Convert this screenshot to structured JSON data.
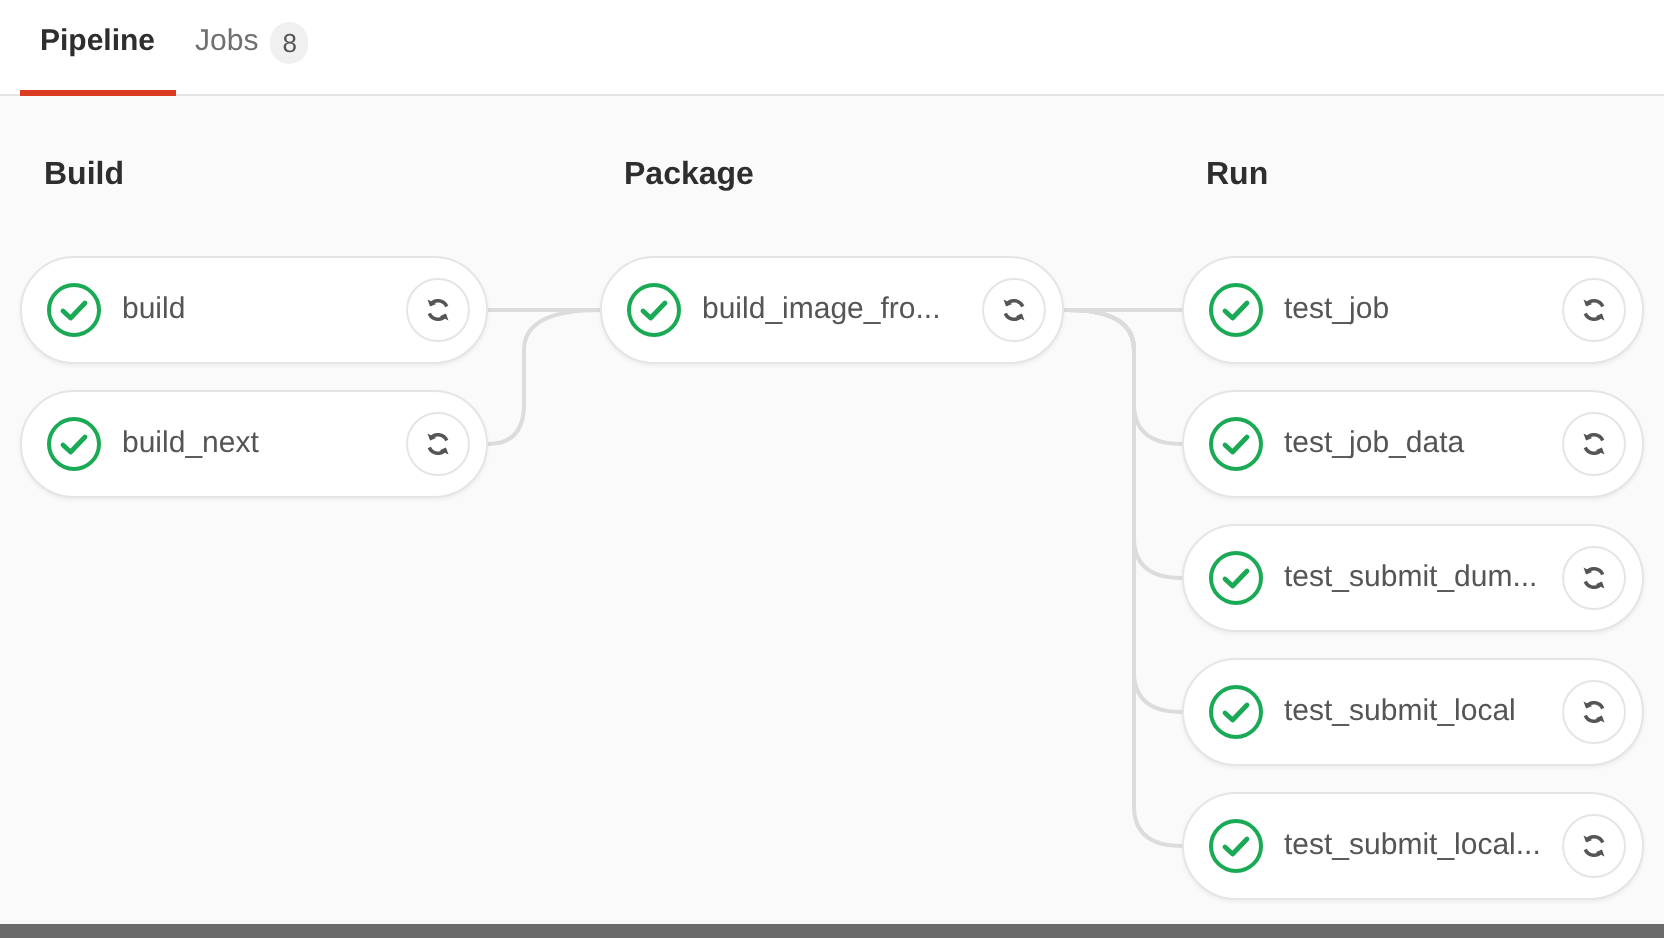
{
  "tabs": [
    {
      "label": "Pipeline",
      "selected": true
    },
    {
      "label": "Jobs",
      "count": "8",
      "selected": false
    }
  ],
  "stages": [
    {
      "title": "Build",
      "jobs": [
        {
          "name": "build",
          "passed": true
        },
        {
          "name": "build_next",
          "passed": true
        }
      ]
    },
    {
      "title": "Package",
      "jobs": [
        {
          "name": "build_image_fro...",
          "passed": true
        }
      ]
    },
    {
      "title": "Run",
      "jobs": [
        {
          "name": "test_job",
          "passed": true
        },
        {
          "name": "test_job_data",
          "passed": true
        },
        {
          "name": "test_submit_dum...",
          "passed": true
        },
        {
          "name": "test_submit_local",
          "passed": true
        },
        {
          "name": "test_submit_local...",
          "passed": true
        }
      ]
    }
  ]
}
